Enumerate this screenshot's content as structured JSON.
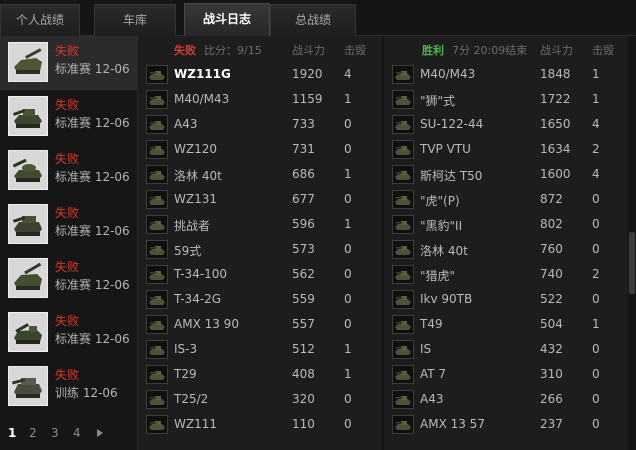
{
  "tabs": [
    {
      "label": "个人战绩",
      "active": false
    },
    {
      "label": "车库",
      "active": false
    },
    {
      "label": "战斗日志",
      "active": true
    },
    {
      "label": "总战绩",
      "active": false
    }
  ],
  "battles": [
    {
      "result": "失败",
      "mode": "标准赛 12-06",
      "tank_icon": "tank-destroyer-icon"
    },
    {
      "result": "失败",
      "mode": "标准赛 12-06",
      "tank_icon": "heavy-tank-icon"
    },
    {
      "result": "失败",
      "mode": "标准赛 12-06",
      "tank_icon": "medium-tank-icon"
    },
    {
      "result": "失败",
      "mode": "标准赛 12-06",
      "tank_icon": "heavy-tank-icon"
    },
    {
      "result": "失败",
      "mode": "标准赛 12-06",
      "tank_icon": "tank-destroyer-icon"
    },
    {
      "result": "失败",
      "mode": "标准赛 12-06",
      "tank_icon": "spg-icon"
    },
    {
      "result": "失败",
      "mode": "训练 12-06",
      "tank_icon": "tiger-tank-icon"
    }
  ],
  "pagination": {
    "pages": [
      "1",
      "2",
      "3",
      "4"
    ],
    "current": "1",
    "next_icon": "triangle-right-icon"
  },
  "loss_team": {
    "result": "失败",
    "score": "比分：9/15",
    "col_power": "战斗力",
    "col_kills": "击毁",
    "rows": [
      {
        "name": "WZ111G",
        "power": "1920",
        "kills": "4",
        "self": true
      },
      {
        "name": "M40/M43",
        "power": "1159",
        "kills": "1"
      },
      {
        "name": "A43",
        "power": "733",
        "kills": "0"
      },
      {
        "name": "WZ120",
        "power": "731",
        "kills": "0"
      },
      {
        "name": "洛林 40t",
        "power": "686",
        "kills": "1"
      },
      {
        "name": "WZ131",
        "power": "677",
        "kills": "0"
      },
      {
        "name": "挑战者",
        "power": "596",
        "kills": "1"
      },
      {
        "name": "59式",
        "power": "573",
        "kills": "0"
      },
      {
        "name": "T-34-100",
        "power": "562",
        "kills": "0"
      },
      {
        "name": "T-34-2G",
        "power": "559",
        "kills": "0"
      },
      {
        "name": "AMX 13 90",
        "power": "557",
        "kills": "0"
      },
      {
        "name": "IS-3",
        "power": "512",
        "kills": "1"
      },
      {
        "name": "T29",
        "power": "408",
        "kills": "1"
      },
      {
        "name": "T25/2",
        "power": "320",
        "kills": "0"
      },
      {
        "name": "WZ111",
        "power": "110",
        "kills": "0"
      }
    ]
  },
  "win_team": {
    "result": "胜利",
    "duration": "7分 20:09结束",
    "col_power": "战斗力",
    "col_kills": "击毁",
    "rows": [
      {
        "name": "M40/M43",
        "power": "1848",
        "kills": "1"
      },
      {
        "name": "\"狮\"式",
        "power": "1722",
        "kills": "1"
      },
      {
        "name": "SU-122-44",
        "power": "1650",
        "kills": "4"
      },
      {
        "name": "TVP VTU",
        "power": "1634",
        "kills": "2"
      },
      {
        "name": "斯柯达 T50",
        "power": "1600",
        "kills": "4"
      },
      {
        "name": "\"虎\"(P)",
        "power": "872",
        "kills": "0"
      },
      {
        "name": "\"黑豹\"II",
        "power": "802",
        "kills": "0"
      },
      {
        "name": "洛林 40t",
        "power": "760",
        "kills": "0"
      },
      {
        "name": "\"猎虎\"",
        "power": "740",
        "kills": "2"
      },
      {
        "name": "Ikv 90TB",
        "power": "522",
        "kills": "0"
      },
      {
        "name": "T49",
        "power": "504",
        "kills": "1"
      },
      {
        "name": "IS",
        "power": "432",
        "kills": "0"
      },
      {
        "name": "AT 7",
        "power": "310",
        "kills": "0"
      },
      {
        "name": "A43",
        "power": "266",
        "kills": "0"
      },
      {
        "name": "AMX 13 57",
        "power": "237",
        "kills": "0"
      }
    ]
  },
  "colors": {
    "loss": "#d33a2f",
    "win": "#4fb24f",
    "background": "#1b1b1b"
  }
}
